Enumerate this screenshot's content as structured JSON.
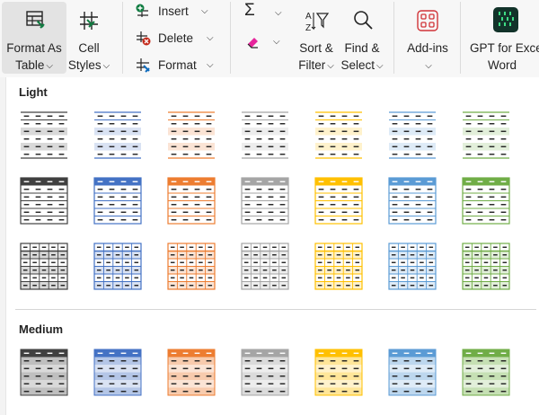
{
  "ribbon": {
    "format_as_table": {
      "line1": "Format As",
      "line2": "Table"
    },
    "cell_styles": {
      "line1": "Cell",
      "line2": "Styles"
    },
    "insert": "Insert",
    "delete": "Delete",
    "format": "Format",
    "sort_filter": {
      "line1": "Sort &",
      "line2": "Filter"
    },
    "find_select": {
      "line1": "Find &",
      "line2": "Select"
    },
    "addins": "Add-ins",
    "gpt": {
      "line1": "GPT for Exce",
      "line2": "Word"
    }
  },
  "gallery": {
    "light_title": "Light",
    "medium_title": "Medium",
    "colors": [
      "#404040",
      "#4472c4",
      "#ed7d31",
      "#a5a5a5",
      "#ffc000",
      "#5b9bd5",
      "#70ad47"
    ],
    "tints": [
      "#d9d9d9",
      "#d9e2f3",
      "#fbe4d5",
      "#ededed",
      "#fff2cc",
      "#deebf7",
      "#e2efda"
    ],
    "medium_tints": [
      "#bfbfbf",
      "#b4c6e7",
      "#f8cbad",
      "#dbdbdb",
      "#ffe699",
      "#bdd7ee",
      "#c6e0b4"
    ]
  }
}
